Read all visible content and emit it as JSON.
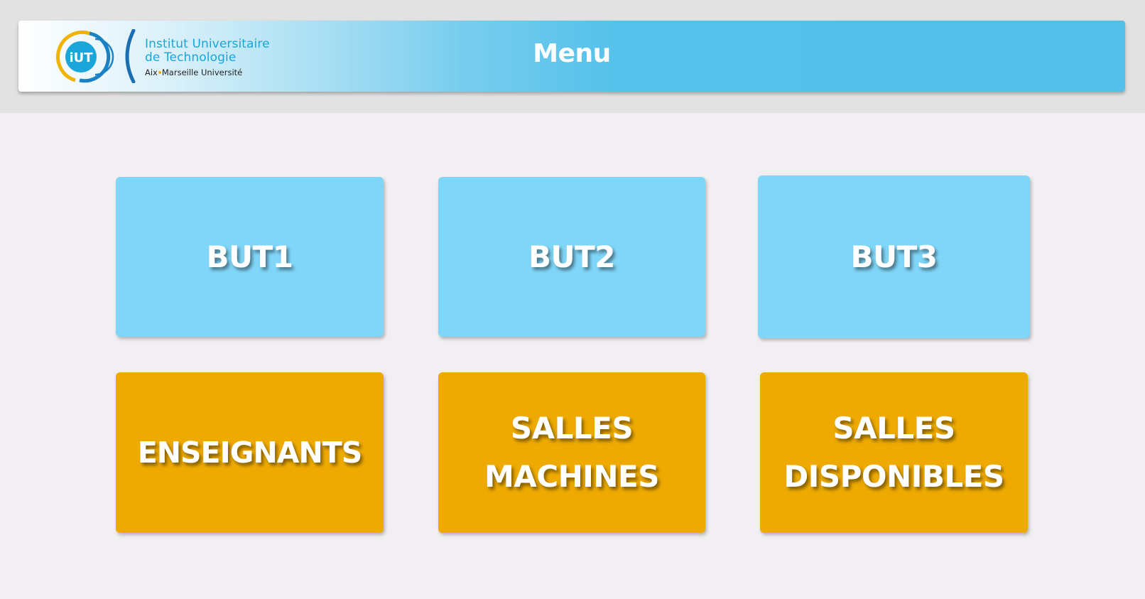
{
  "header": {
    "title": "Menu",
    "logo": {
      "icon_text": "iUT",
      "line1": "Institut Universitaire",
      "line2": "de Technologie",
      "line3_part1": "Aix",
      "line3_part2": "Marseille Université"
    }
  },
  "menu": {
    "row1": [
      {
        "label": "BUT1"
      },
      {
        "label": "BUT2"
      },
      {
        "label": "BUT3"
      }
    ],
    "row2": [
      {
        "label": "ENSEIGNANTS"
      },
      {
        "line1": "SALLES",
        "line2": "MACHINES"
      },
      {
        "line1": "SALLES",
        "line2": "DISPONIBLES"
      }
    ]
  },
  "colors": {
    "header_accent": "#53c0ea",
    "tile_blue": "#80d6f8",
    "tile_orange": "#eeaa00",
    "background": "#f1eff1"
  }
}
